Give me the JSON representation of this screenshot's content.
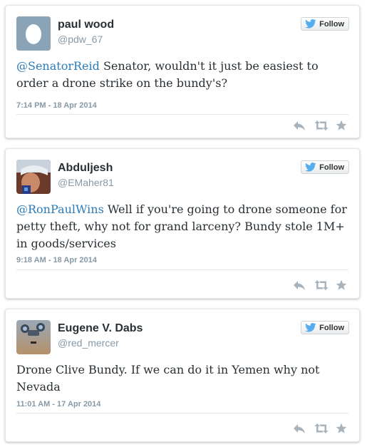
{
  "follow_label": "Follow",
  "colors": {
    "mention": "#2b7bb9",
    "bird": "#55acee",
    "icons": "#a8b3bb"
  },
  "tweets": [
    {
      "name": "paul wood",
      "handle": "@pdw_67",
      "mention": "@SenatorReid",
      "text": " Senator, wouldn't it just be easiest to order a drone strike on the bundy's?",
      "date": "7:14 PM - 18 Apr 2014",
      "avatar_icon": "default-egg-avatar"
    },
    {
      "name": "Abduljesh",
      "handle": "@EMaher81",
      "mention": "@RonPaulWins",
      "text": " Well if you're going to drone someone for petty theft, why not for grand larceny? Bundy stole 1M+ in goods/services",
      "date": "9:18 AM - 18 Apr 2014",
      "avatar_icon": "profile-photo-avatar"
    },
    {
      "name": "Eugene V. Dabs",
      "handle": "@red_mercer",
      "mention": "",
      "text": "Drone Clive Bundy. If we can do it in Yemen why not Nevada",
      "date": "11:01 AM - 17 Apr 2014",
      "avatar_icon": "drone-photo-avatar"
    }
  ],
  "action_icons": [
    "reply-icon",
    "retweet-icon",
    "favorite-icon"
  ]
}
